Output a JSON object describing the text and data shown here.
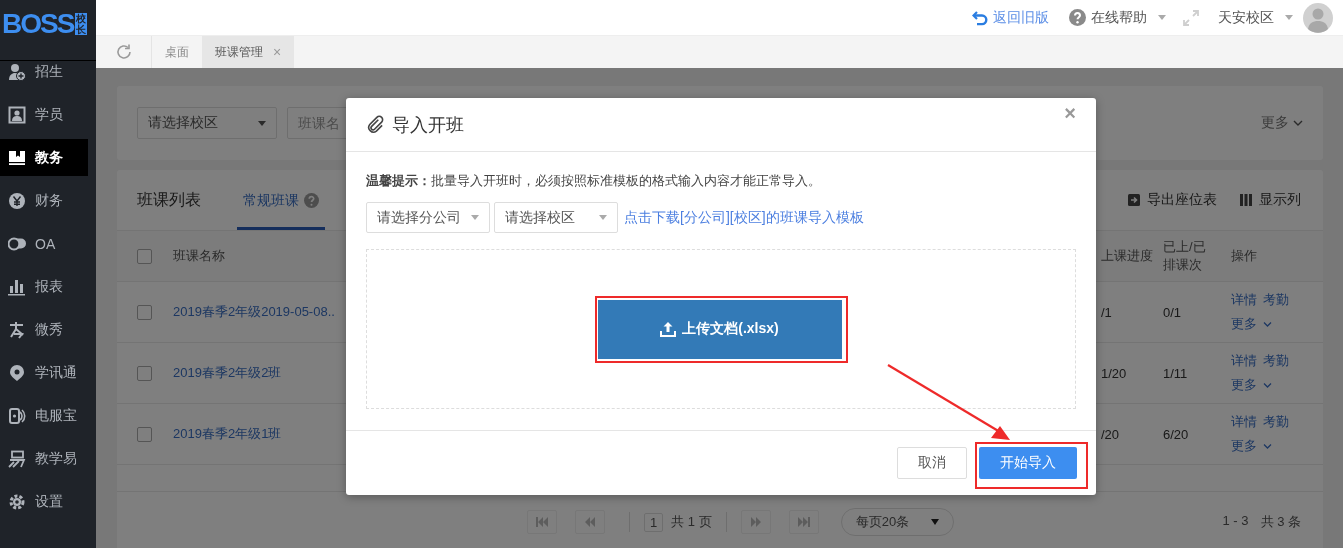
{
  "logo": {
    "text": "BOSS",
    "badge": "校长"
  },
  "topbar": {
    "links": [
      {
        "kind": "back",
        "label": "返回旧版"
      },
      {
        "kind": "help",
        "label": "在线帮助"
      }
    ],
    "campus": "天安校区"
  },
  "tabs": [
    {
      "label": "桌面",
      "selected": false
    },
    {
      "label": "班课管理",
      "selected": true,
      "close": "×"
    }
  ],
  "sidebar": {
    "items": [
      {
        "kind": "enroll",
        "label": "招生",
        "selected": false
      },
      {
        "kind": "student",
        "label": "学员",
        "selected": false
      },
      {
        "kind": "teaching",
        "label": "教务",
        "selected": true
      },
      {
        "kind": "finance",
        "label": "财务",
        "selected": false
      },
      {
        "kind": "oa",
        "label": "OA",
        "selected": false
      },
      {
        "kind": "report",
        "label": "报表",
        "selected": false
      },
      {
        "kind": "show",
        "label": "微秀",
        "selected": false
      },
      {
        "kind": "pin",
        "label": "学讯通",
        "selected": false
      },
      {
        "kind": "phone",
        "label": "电服宝",
        "selected": false
      },
      {
        "kind": "easy",
        "label": "教学易",
        "selected": false
      },
      {
        "kind": "gear",
        "label": "设置",
        "selected": false
      }
    ]
  },
  "filter": {
    "campus_select": "请选择校区",
    "name_placeholder": "班课名",
    "more": "更多"
  },
  "list": {
    "title": "班课列表",
    "tabs": [
      {
        "label": "常规班课",
        "selected": true
      }
    ],
    "tools": [
      {
        "kind": "export",
        "label": "导出座位表"
      },
      {
        "kind": "columns",
        "label": "显示列"
      }
    ]
  },
  "table": {
    "all_checked": false,
    "columns": [
      "班课名称",
      "上课进度",
      "已上/已排课次",
      "操作"
    ],
    "rows": [
      {
        "checked": false,
        "name": "2019春季2年级2019-05-08..",
        "progress": "/1",
        "count": "0/1",
        "actions": [
          "详情",
          "考勤",
          "更多"
        ]
      },
      {
        "checked": false,
        "name": "2019春季2年级2班",
        "progress": "1/20",
        "count": "1/11",
        "actions": [
          "详情",
          "考勤",
          "更多"
        ]
      },
      {
        "checked": false,
        "name": "2019春季2年级1班",
        "progress": "/20",
        "count": "6/20",
        "actions": [
          "详情",
          "考勤",
          "更多"
        ]
      }
    ]
  },
  "pagination": {
    "page": "1",
    "total_pages": "共 1 页",
    "page_size": "每页20条",
    "range": "1 - 3",
    "total": "共 3 条"
  },
  "modal": {
    "title": "导入开班",
    "close": "×",
    "tip": "**温馨提示：**批量导入开班时，必须按照标准模板的格式输入内容才能正常导入。",
    "selects": [
      "请选择分公司",
      "请选择校区"
    ],
    "template_link": "点击下载[分公司][校区]的班课导入模板",
    "upload_button": {
      "label": "上传文档(.xlsx)",
      "highlighted": true
    },
    "cancel_button": "取消",
    "start_button": {
      "label": "开始导入",
      "highlighted": true
    },
    "annotation_arrow": true
  }
}
